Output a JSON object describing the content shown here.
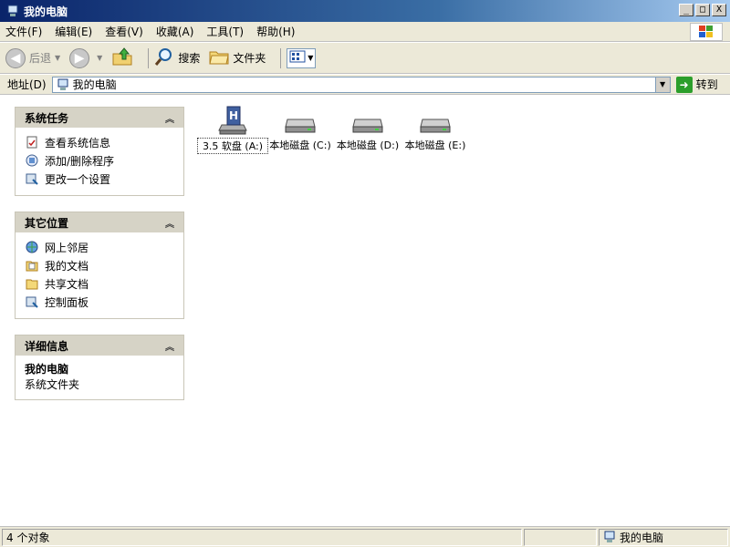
{
  "window": {
    "title": "我的电脑",
    "buttons": [
      "_",
      "□",
      "X"
    ]
  },
  "menu": {
    "items": [
      "文件(F)",
      "编辑(E)",
      "查看(V)",
      "收藏(A)",
      "工具(T)",
      "帮助(H)"
    ]
  },
  "toolbar": {
    "back_label": "后退",
    "search_label": "搜索",
    "folders_label": "文件夹"
  },
  "address": {
    "label": "地址(D)",
    "value": "我的电脑",
    "go_label": "转到"
  },
  "panels": {
    "system_tasks": {
      "title": "系统任务",
      "items": [
        "查看系统信息",
        "添加/删除程序",
        "更改一个设置"
      ]
    },
    "other_places": {
      "title": "其它位置",
      "items": [
        "网上邻居",
        "我的文档",
        "共享文档",
        "控制面板"
      ]
    },
    "details": {
      "title": "详细信息",
      "name": "我的电脑",
      "desc": "系统文件夹"
    }
  },
  "drives": [
    "3.5 软盘 (A:)",
    "本地磁盘 (C:)",
    "本地磁盘 (D:)",
    "本地磁盘 (E:)"
  ],
  "status": {
    "count": "4 个对象",
    "location": "我的电脑"
  },
  "colors": {
    "title_start": "#0a246a",
    "title_end": "#a6caf0",
    "chrome": "#ece9d8",
    "panel_head": "#d6d3c6"
  }
}
